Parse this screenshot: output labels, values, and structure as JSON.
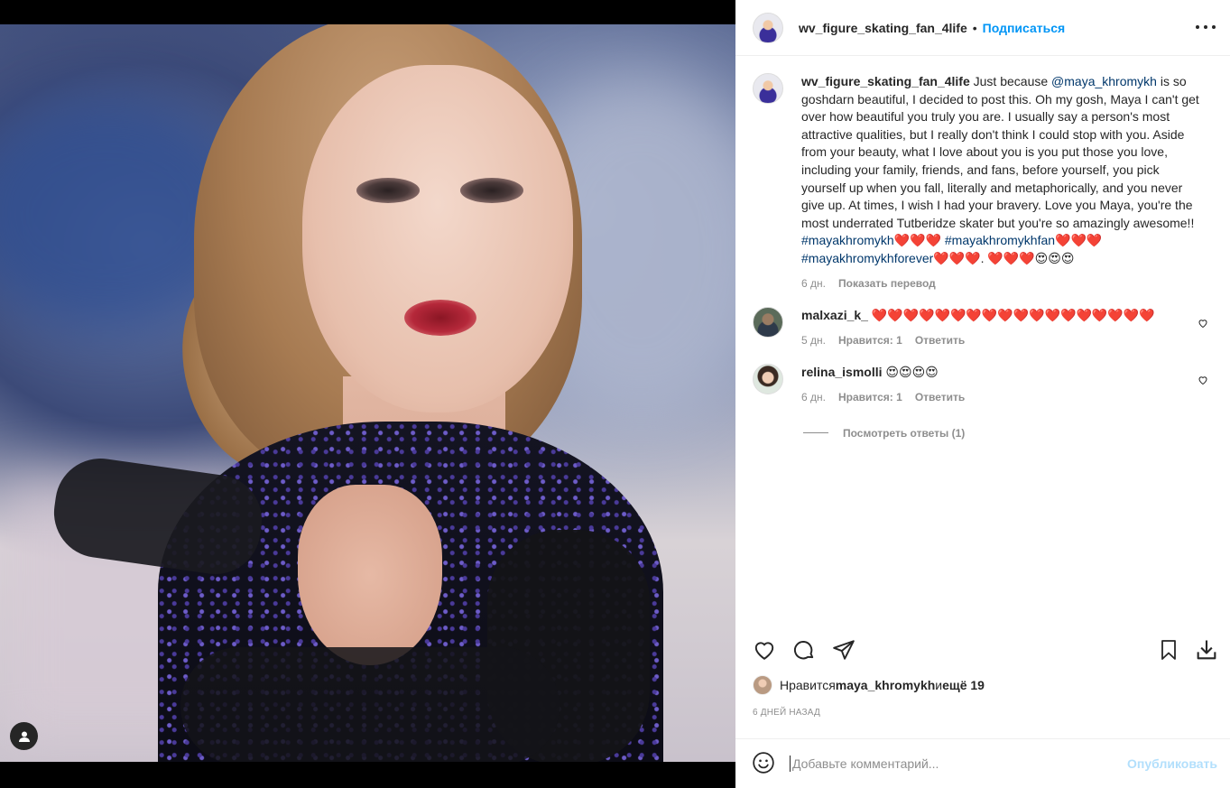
{
  "post": {
    "author": "wv_figure_skating_fan_4life",
    "dot": "•",
    "follow_label": "Подписаться"
  },
  "caption": {
    "author": "wv_figure_skating_fan_4life",
    "text_before": " Just because ",
    "mention": "@maya_khromykh",
    "text_after": " is so goshdarn beautiful, I decided to post this. Oh my gosh, Maya I can't get over how beautiful you truly you are. I usually say a person's most attractive qualities, but I really don't think I could stop with you. Aside from your beauty, what I love about you is you put those you love, including your family, friends, and fans, before yourself, you pick yourself up when you fall, literally and metaphorically, and you never give up. At times, I wish I had your bravery. Love you Maya, you're the most underrated Tutberidze skater but you're so amazingly awesome!! ",
    "tag1": "#mayakhromykh",
    "emoji1": "❤️❤️❤️ ",
    "tag2": "#mayakhromykhfan",
    "emoji2": "❤️❤️❤️ ",
    "tag3": "#mayakhromykhforever",
    "emoji3": "❤️❤️❤️. ❤️❤️❤️😍😍😍",
    "time": "6 дн.",
    "translate": "Показать перевод"
  },
  "comments": [
    {
      "user": "malxazi_k_",
      "text": "❤️❤️❤️❤️❤️❤️❤️❤️❤️❤️❤️❤️❤️❤️❤️❤️❤️❤️",
      "time": "5 дн.",
      "likes": "Нравится: 1",
      "reply": "Ответить"
    },
    {
      "user": "relina_ismolli",
      "text": "😍😍😍😍",
      "time": "6 дн.",
      "likes": "Нравится: 1",
      "reply": "Ответить",
      "view_replies": "Посмотреть ответы (1)"
    }
  ],
  "likes_summary": {
    "prefix": "Нравится ",
    "user": "maya_khromykh",
    "mid": " и ",
    "others": "ещё 19"
  },
  "posted_ago": "6 ДНЕЙ НАЗАД",
  "add_comment": {
    "placeholder": "Добавьте комментарий...",
    "post_label": "Опубликовать"
  },
  "icons": [
    "heart-icon",
    "comment-icon",
    "share-icon",
    "bookmark-icon",
    "download-icon",
    "emoji-icon",
    "more-icon",
    "user-tag-icon"
  ]
}
